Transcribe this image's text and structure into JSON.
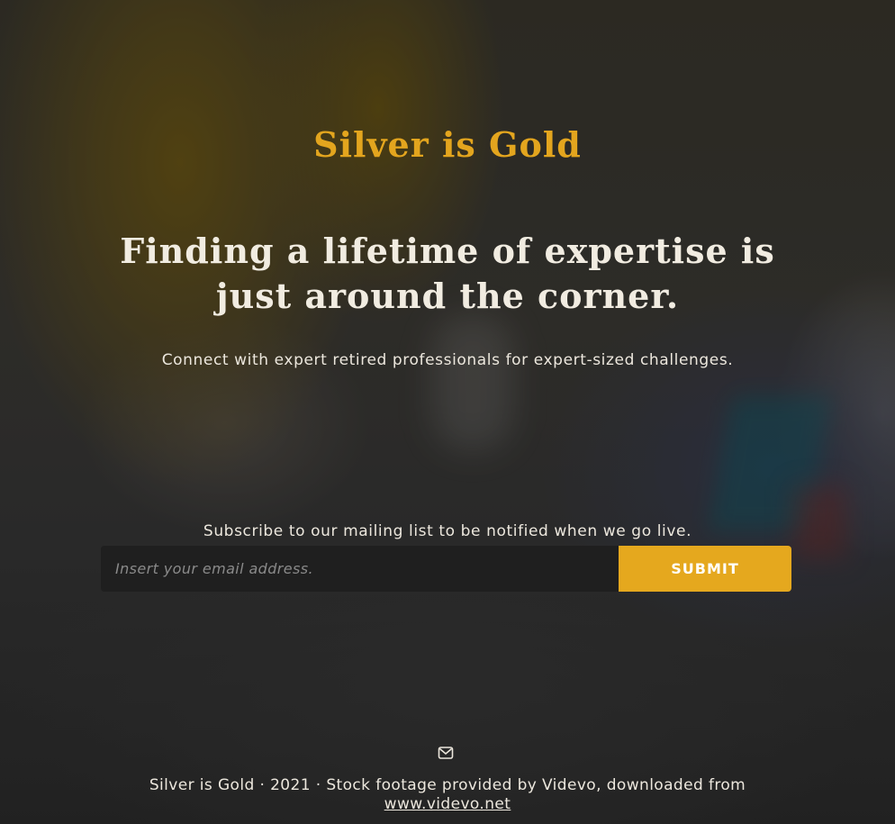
{
  "brand": {
    "name": "Silver is Gold",
    "color": "#e3a51e"
  },
  "hero": {
    "headline": "Finding a lifetime of expertise is just around the corner.",
    "tagline": "Connect with expert retired professionals for expert-sized challenges."
  },
  "signup": {
    "label": "Subscribe to our mailing list to be notified when we go live.",
    "email_placeholder": "Insert your email address.",
    "email_value": "",
    "submit_label": "SUBMIT",
    "accent_color": "#e5a81e"
  },
  "footer": {
    "icon": "envelope-icon",
    "credit_text": "Silver is Gold · 2021 · Stock footage provided by Videvo, downloaded from",
    "link_text": "www.videvo.net"
  }
}
